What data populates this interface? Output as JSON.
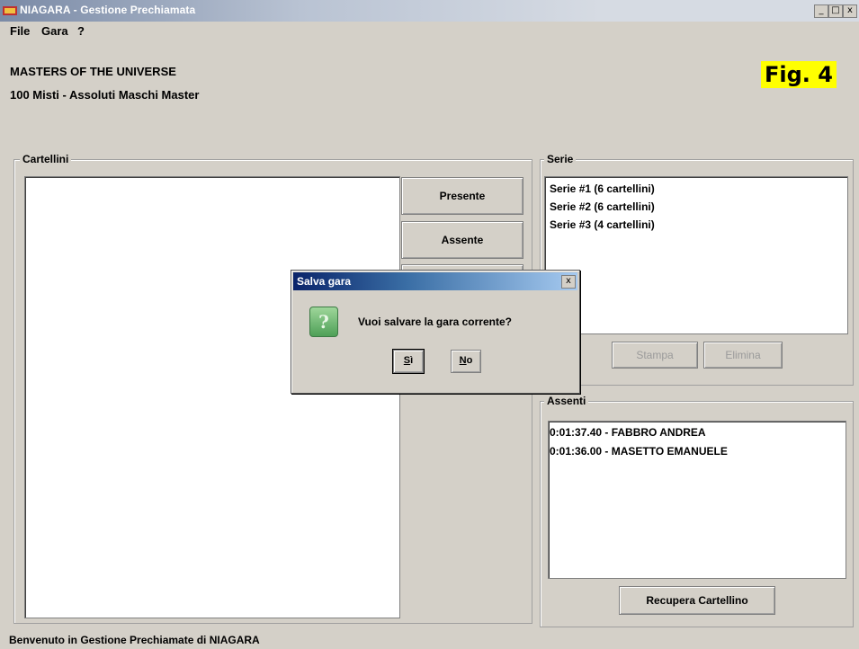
{
  "window": {
    "title": "NIAGARA - Gestione Prechiamata",
    "controls": {
      "minimize": "_",
      "maximize": "□",
      "close": "x"
    }
  },
  "menu": {
    "items": [
      "File",
      "Gara",
      "?"
    ]
  },
  "header": {
    "event": "MASTERS OF THE UNIVERSE",
    "race": "100 Misti - Assoluti Maschi Master"
  },
  "figure_label": "Fig. 4",
  "cartellini": {
    "title": "Cartellini",
    "buttons": {
      "presente": "Presente",
      "assente": "Assente"
    }
  },
  "serie": {
    "title": "Serie",
    "items": [
      "Serie #1 (6 cartellini)",
      "Serie #2 (6 cartellini)",
      "Serie #3 (4 cartellini)"
    ],
    "buttons": {
      "stampa": "Stampa",
      "elimina": "Elimina"
    }
  },
  "assenti": {
    "title": "Assenti",
    "items": [
      "0:01:37.40 - FABBRO ANDREA",
      "0:01:36.00 - MASETTO EMANUELE"
    ],
    "button": "Recupera Cartellino"
  },
  "status_text": "Benvenuto in Gestione Prechiamate di NIAGARA",
  "dialog": {
    "title": "Salva gara",
    "close": "x",
    "icon_glyph": "?",
    "message": "Vuoi salvare la gara corrente?",
    "yes": {
      "underlined": "S",
      "rest": "ì"
    },
    "no": {
      "underlined": "N",
      "rest": "o"
    }
  }
}
